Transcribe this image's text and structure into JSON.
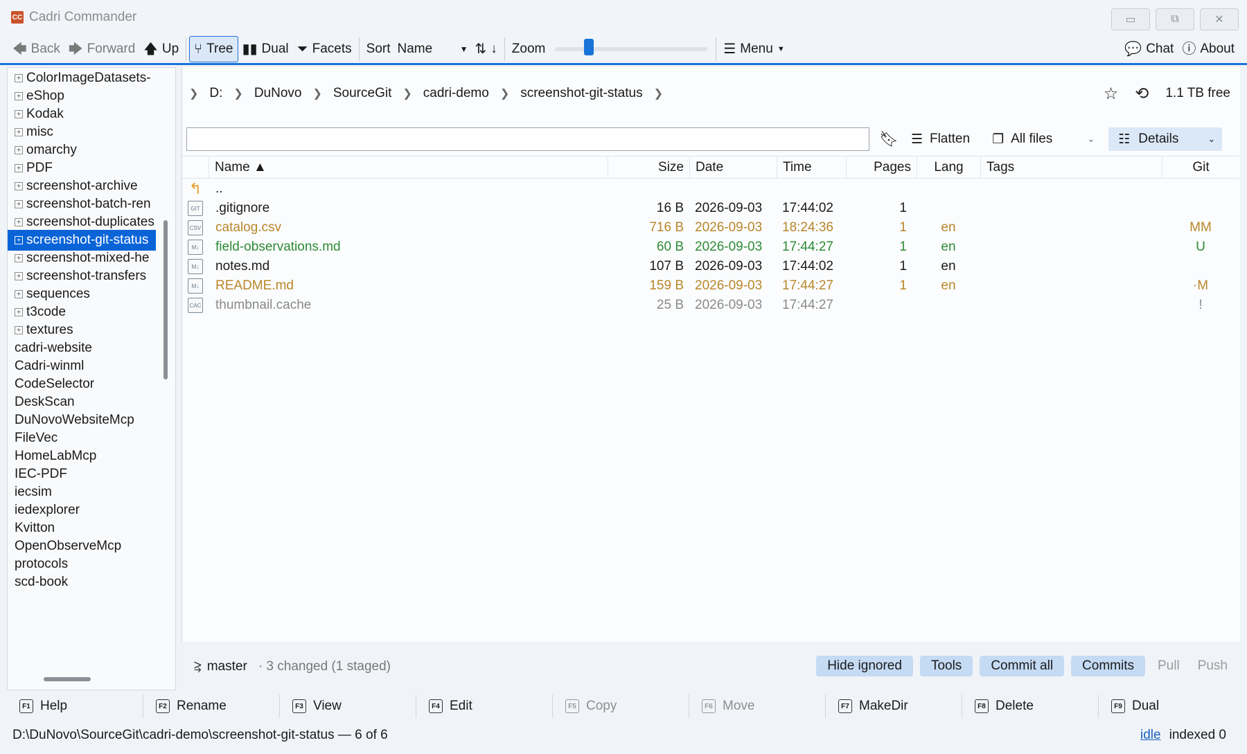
{
  "window": {
    "title": "Cadri Commander",
    "logo_text": "CC"
  },
  "toolbar": {
    "back": "Back",
    "forward": "Forward",
    "up": "Up",
    "tree": "Tree",
    "dual": "Dual",
    "facets": "Facets",
    "sort_label": "Sort",
    "sort_value": "Name",
    "sort_dir": "↓",
    "zoom_label": "Zoom",
    "zoom_level": 0.2,
    "menu": "Menu",
    "chat": "Chat",
    "about": "About"
  },
  "tree": {
    "items": [
      {
        "label": "ColorImageDatasets-",
        "expander": "+",
        "level": 1
      },
      {
        "label": "eShop",
        "expander": "+",
        "level": 1
      },
      {
        "label": "Kodak",
        "expander": "+",
        "level": 1
      },
      {
        "label": "misc",
        "expander": "+",
        "level": 1
      },
      {
        "label": "omarchy",
        "expander": "+",
        "level": 1
      },
      {
        "label": "PDF",
        "expander": "+",
        "level": 1
      },
      {
        "label": "screenshot-archive",
        "expander": "+",
        "level": 1
      },
      {
        "label": "screenshot-batch-ren",
        "expander": "+",
        "level": 1
      },
      {
        "label": "screenshot-duplicates",
        "expander": "+",
        "level": 1
      },
      {
        "label": "screenshot-git-status",
        "expander": "+",
        "level": 1,
        "selected": true
      },
      {
        "label": "screenshot-mixed-he",
        "expander": "+",
        "level": 1
      },
      {
        "label": "screenshot-transfers",
        "expander": "+",
        "level": 1
      },
      {
        "label": "sequences",
        "expander": "+",
        "level": 1
      },
      {
        "label": "t3code",
        "expander": "+",
        "level": 1
      },
      {
        "label": "textures",
        "expander": "+",
        "level": 1
      },
      {
        "label": "cadri-website",
        "expander": "",
        "level": 0
      },
      {
        "label": "Cadri-winml",
        "expander": "",
        "level": 0
      },
      {
        "label": "CodeSelector",
        "expander": "",
        "level": 0
      },
      {
        "label": "DeskScan",
        "expander": "",
        "level": 0
      },
      {
        "label": "DuNovoWebsiteMcp",
        "expander": "",
        "level": 0
      },
      {
        "label": "FileVec",
        "expander": "",
        "level": 0
      },
      {
        "label": "HomeLabMcp",
        "expander": "",
        "level": 0
      },
      {
        "label": "IEC-PDF",
        "expander": "",
        "level": 0
      },
      {
        "label": "iecsim",
        "expander": "",
        "level": 0
      },
      {
        "label": "iedexplorer",
        "expander": "",
        "level": 0
      },
      {
        "label": "Kvitton",
        "expander": "",
        "level": 0
      },
      {
        "label": "OpenObserveMcp",
        "expander": "",
        "level": 0
      },
      {
        "label": "protocols",
        "expander": "",
        "level": 0
      },
      {
        "label": "scd-book",
        "expander": "",
        "level": 0
      }
    ]
  },
  "breadcrumb": {
    "parts": [
      "D:",
      "DuNovo",
      "SourceGit",
      "cadri-demo",
      "screenshot-git-status"
    ],
    "free_space": "1.1 TB free"
  },
  "filter": {
    "value": "",
    "flatten": "Flatten",
    "files": "All files",
    "view": "Details"
  },
  "table": {
    "columns": {
      "name": "Name ▲",
      "size": "Size",
      "date": "Date",
      "time": "Time",
      "pages": "Pages",
      "lang": "Lang",
      "tags": "Tags",
      "git": "Git"
    },
    "parent_label": "..",
    "rows": [
      {
        "icon": "GIT",
        "name": ".gitignore",
        "size": "16 B",
        "date": "2026-09-03",
        "time": "17:44:02",
        "pages": "1",
        "lang": "",
        "git": "",
        "color": "#1a1a1a",
        "dot": ""
      },
      {
        "icon": "CSV",
        "name": "catalog.csv",
        "size": "716 B",
        "date": "2026-09-03",
        "time": "18:24:36",
        "pages": "1",
        "lang": "en",
        "git": "MM",
        "color": "#b8862a",
        "dot": "#e8a33a"
      },
      {
        "icon": "M↓",
        "name": "field-observations.md",
        "size": "60 B",
        "date": "2026-09-03",
        "time": "17:44:27",
        "pages": "1",
        "lang": "en",
        "git": "U",
        "color": "#2e8b36",
        "dot": "#3aa546"
      },
      {
        "icon": "M↓",
        "name": "notes.md",
        "size": "107 B",
        "date": "2026-09-03",
        "time": "17:44:02",
        "pages": "1",
        "lang": "en",
        "git": "",
        "color": "#1a1a1a",
        "dot": ""
      },
      {
        "icon": "M↓",
        "name": "README.md",
        "size": "159 B",
        "date": "2026-09-03",
        "time": "17:44:27",
        "pages": "1",
        "lang": "en",
        "git": "·M",
        "color": "#b8862a",
        "dot": "#e8a33a"
      },
      {
        "icon": "CAC",
        "name": "thumbnail.cache",
        "size": "25 B",
        "date": "2026-09-03",
        "time": "17:44:27",
        "pages": "",
        "lang": "",
        "git": "!",
        "color": "#8a8a8a",
        "dot": ""
      }
    ]
  },
  "git": {
    "branch": "master",
    "changed": "· 3 changed (1 staged)",
    "hide_ignored": "Hide ignored",
    "tools": "Tools",
    "commit_all": "Commit all",
    "commits": "Commits",
    "pull": "Pull",
    "push": "Push"
  },
  "fkeys": [
    {
      "key": "F1",
      "label": "Help",
      "enabled": true
    },
    {
      "key": "F2",
      "label": "Rename",
      "enabled": true
    },
    {
      "key": "F3",
      "label": "View",
      "enabled": true
    },
    {
      "key": "F4",
      "label": "Edit",
      "enabled": true
    },
    {
      "key": "F5",
      "label": "Copy",
      "enabled": false
    },
    {
      "key": "F6",
      "label": "Move",
      "enabled": false
    },
    {
      "key": "F7",
      "label": "MakeDir",
      "enabled": true
    },
    {
      "key": "F8",
      "label": "Delete",
      "enabled": true
    },
    {
      "key": "F9",
      "label": "Dual",
      "enabled": true
    }
  ],
  "status": {
    "path": "D:\\DuNovo\\SourceGit\\cadri-demo\\screenshot-git-status — 6 of 6",
    "idle": "idle",
    "indexed": "indexed 0"
  },
  "colors": {
    "accent": "#1a73d9",
    "selection": "#0a64d8",
    "modified": "#b8862a",
    "untracked": "#2e8b36",
    "ignored": "#8a8a8a"
  }
}
